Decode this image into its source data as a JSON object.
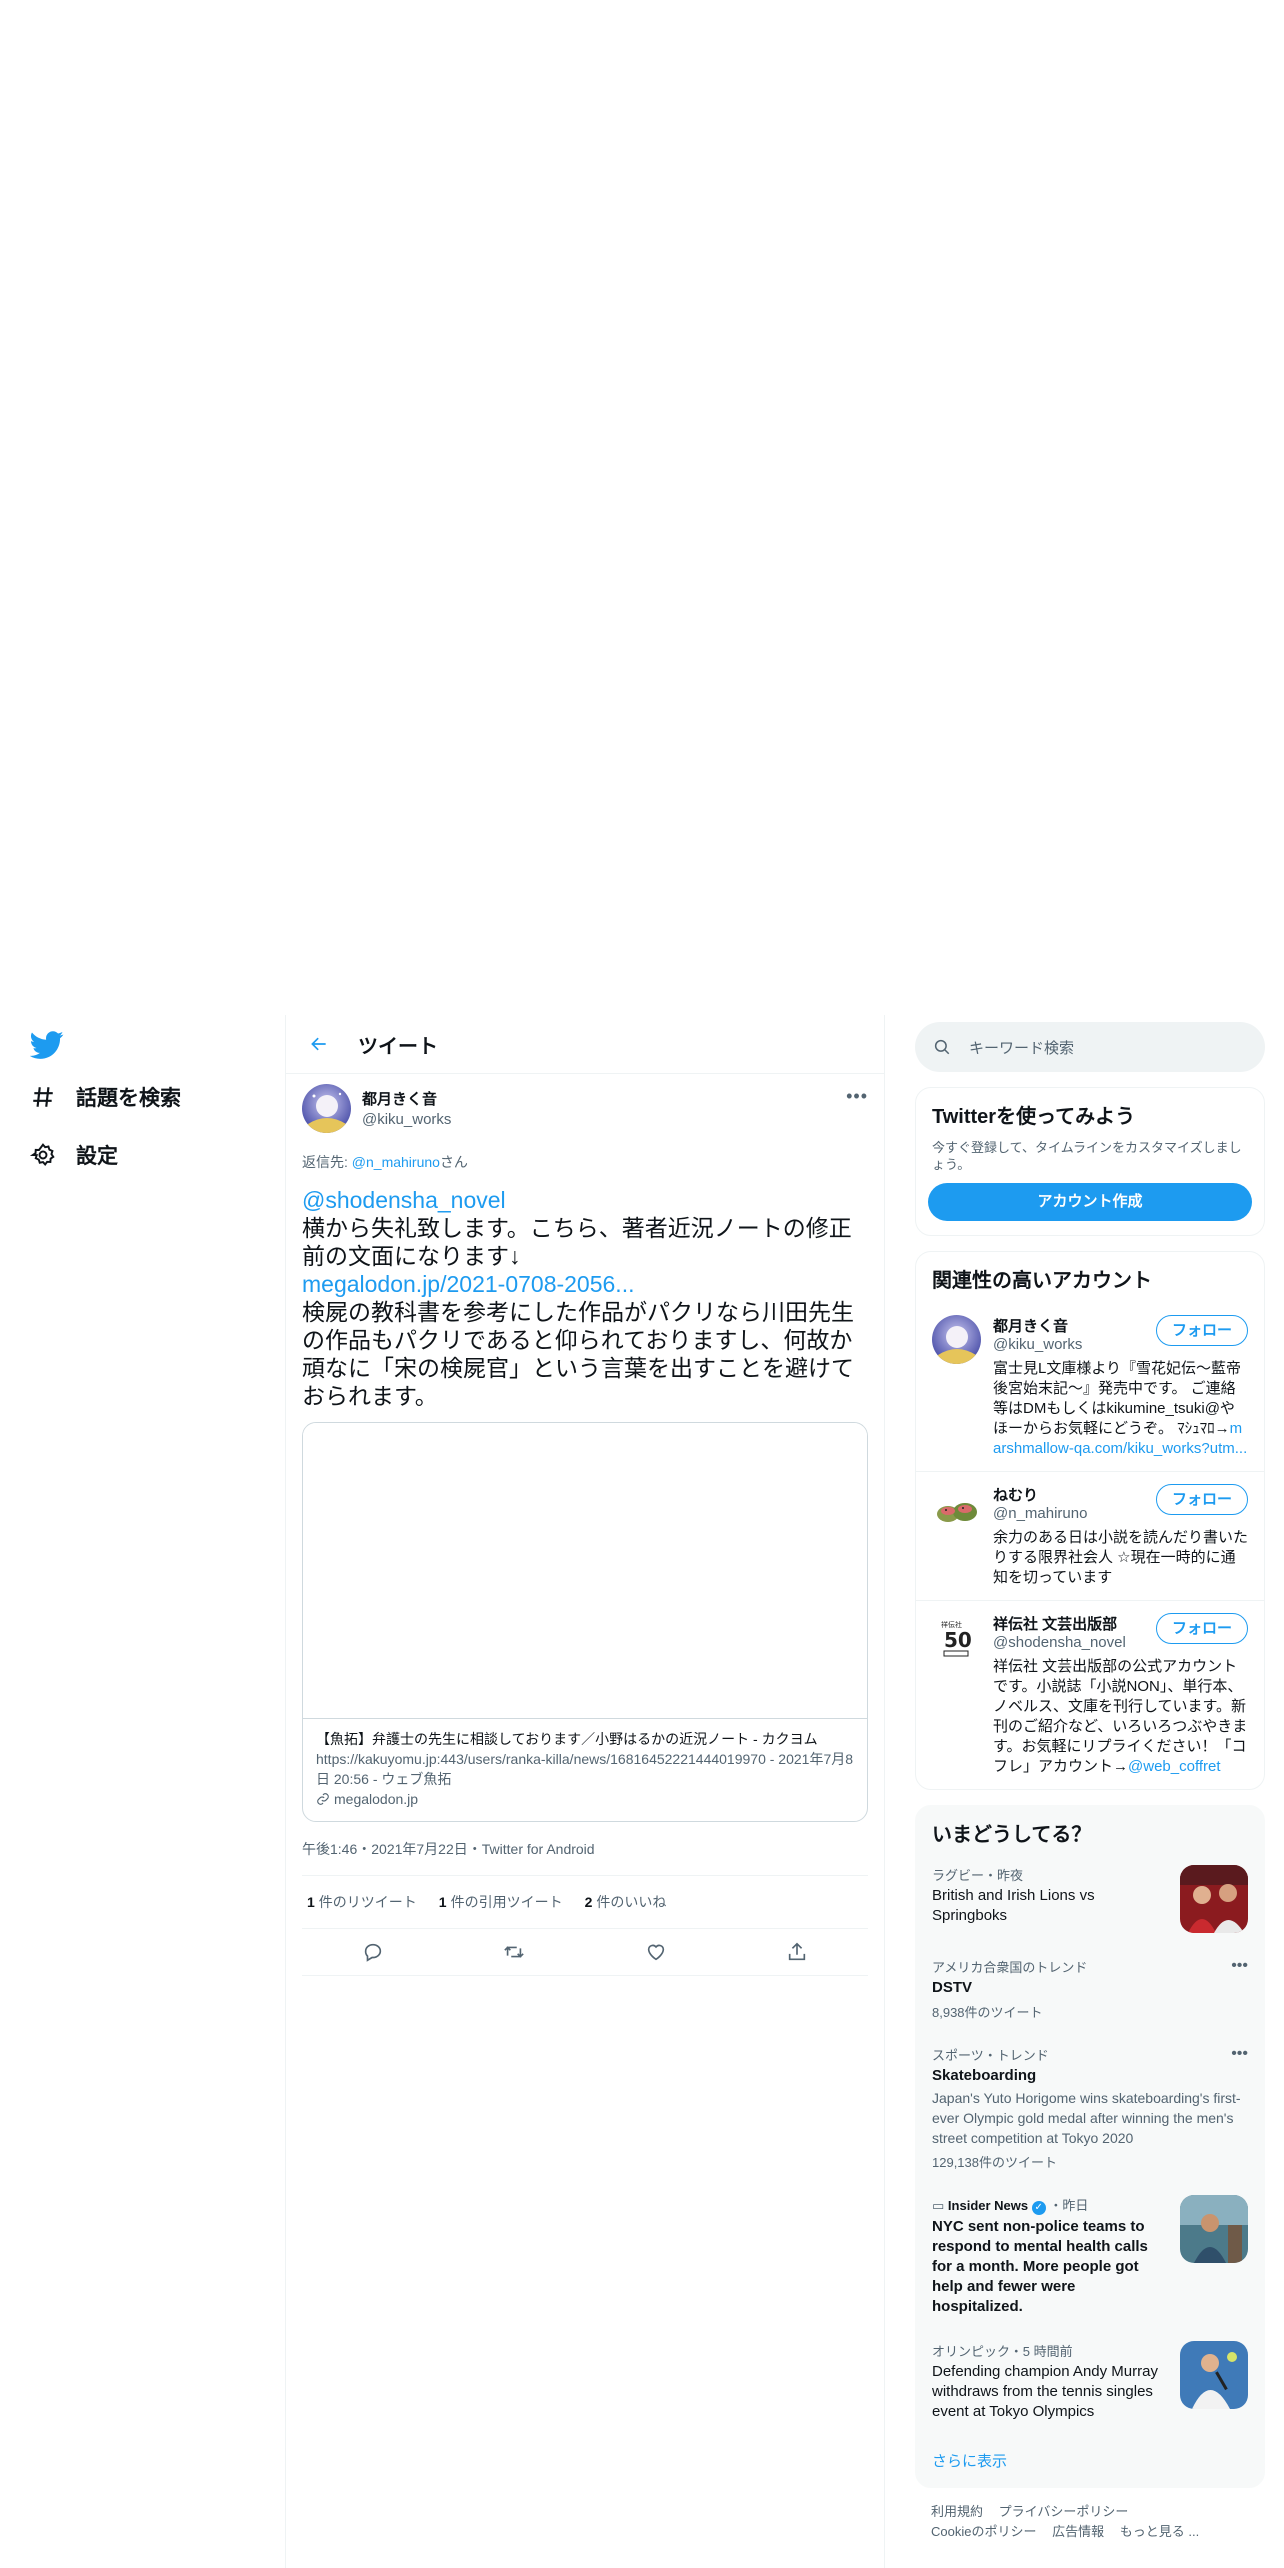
{
  "nav": {
    "items": [
      {
        "label": "話題を検索"
      },
      {
        "label": "設定"
      }
    ]
  },
  "header": {
    "title": "ツイート"
  },
  "tweet": {
    "author_name": "都月きく音",
    "author_handle": "@kiku_works",
    "reply_prefix": "返信先: ",
    "reply_handle": "@n_mahiruno",
    "reply_suffix": "さん",
    "mention": "@shodensha_novel",
    "text1": "横から失礼致します。こちら、著者近況ノートの修正前の文面になります↓",
    "link": "megalodon.jp/2021-0708-2056...",
    "text2": "検屍の教科書を参考にした作品がパクリなら川田先生の作品もパクリであると仰られておりますし、何故か頑なに「宋の検屍官」という言葉を出すことを避けておられます。",
    "card": {
      "title": "【魚拓】弁護士の先生に相談しております／小野はるかの近況ノート - カクヨム",
      "desc": "https://kakuyomu.jp:443/users/ranka-killa/news/16816452221444019970 - 2021年7月8日 20:56 - ウェブ魚拓",
      "domain": "megalodon.jp"
    },
    "meta": "午後1:46・2021年7月22日・Twitter for Android",
    "stats": [
      {
        "count": "1",
        "label": "件のリツイート"
      },
      {
        "count": "1",
        "label": "件の引用ツイート"
      },
      {
        "count": "2",
        "label": "件のいいね"
      }
    ]
  },
  "search": {
    "placeholder": "キーワード検索"
  },
  "signup": {
    "title": "Twitterを使ってみよう",
    "desc": "今すぐ登録して、タイムラインをカスタマイズしましょう。",
    "button": "アカウント作成"
  },
  "related": {
    "title": "関連性の高いアカウント",
    "follow_label": "フォロー",
    "accounts": [
      {
        "name": "都月きく音",
        "handle": "@kiku_works",
        "bio": "富士見L文庫様より『雪花妃伝～藍帝後宮始末記～』発売中です。 ご連絡等はDMもしくはkikumine_tsuki@やほーからお気軽にどうぞ。 ﾏｼｭﾏﾛ→",
        "bio_link": "marshmallow-qa.com/kiku_works?utm..."
      },
      {
        "name": "ねむり",
        "handle": "@n_mahiruno",
        "bio": "余力のある日は小説を読んだり書いたりする限界社会人 ☆現在一時的に通知を切っています",
        "bio_link": ""
      },
      {
        "name": "祥伝社 文芸出版部",
        "handle": "@shodensha_novel",
        "bio": "祥伝社 文芸出版部の公式アカウントです。小説誌「小説NON」、単行本、ノベルス、文庫を刊行しています。新刊のご紹介など、いろいろつぶやきます。お気軽にリプライください！「コフレ」アカウント→",
        "bio_link": "@web_coffret"
      }
    ]
  },
  "trends": {
    "title": "いまどうしてる？",
    "items": [
      {
        "context": "ラグビー・昨夜",
        "title": "British and Irish Lions vs Springboks"
      },
      {
        "context": "アメリカ合衆国のトレンド",
        "title": "DSTV",
        "count": "8,938件のツイート"
      },
      {
        "context": "スポーツ・トレンド",
        "title": "Skateboarding",
        "desc": "Japan's Yuto Horigome wins skateboarding's first-ever Olympic gold medal after winning the men's street competition at Tokyo 2020",
        "count": "129,138件のツイート"
      },
      {
        "source": "Insider News",
        "time": "・昨日",
        "title": "NYC sent non-police teams to respond to mental health calls for a month. More people got help and fewer were hospitalized."
      },
      {
        "context": "オリンピック・5 時間前",
        "title": "Defending champion Andy Murray withdraws from the tennis singles event at Tokyo Olympics"
      }
    ],
    "show_more": "さらに表示"
  },
  "footer": {
    "links": [
      "利用規約",
      "プライバシーポリシー",
      "Cookieのポリシー",
      "広告情報",
      "もっと見る ..."
    ]
  },
  "colors": {
    "accent": "#1d9bf0",
    "text": "#0f1419",
    "muted": "#536471",
    "border": "#eff3f4"
  }
}
